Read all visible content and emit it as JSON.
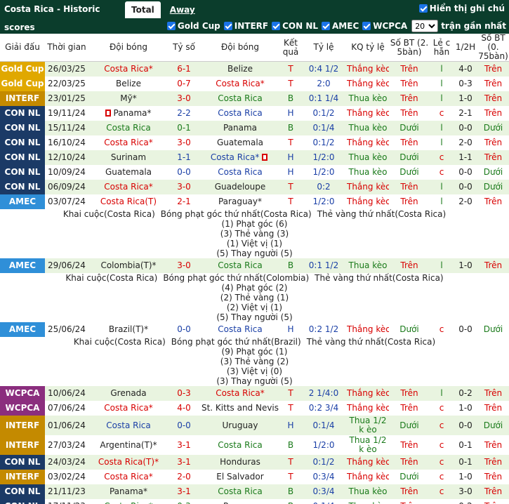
{
  "title": "Costa Rica - Historic scores",
  "tabs": [
    {
      "label": "Total"
    },
    {
      "label": "Away"
    }
  ],
  "show_notes_label": "Hiển thị ghi chú",
  "filters": [
    {
      "label": "Gold Cup"
    },
    {
      "label": "INTERF"
    },
    {
      "label": "CON NL"
    },
    {
      "label": "AMEC"
    },
    {
      "label": "WCPCA"
    }
  ],
  "recent": {
    "value": "20",
    "label": "trận gần nhất"
  },
  "columns": {
    "league": "Giải đấu",
    "time": "Thời gian",
    "home": "Đội bóng",
    "score": "Tỷ số",
    "away": "Đội bóng",
    "result": "Kết quả",
    "odds": "Tỷ lệ",
    "odds_result": "KQ tỷ lệ",
    "goals5": "Số BT (2. 5bàn)",
    "evenodd": "Lẻ c hẵn",
    "half": "1/2H",
    "goals75": "Số BT (0. 75bàn)"
  },
  "colors": {
    "gold": "#e0a800",
    "interf": "#c48a00",
    "conl": "#1b3a66",
    "amec": "#2f8fd8",
    "wcpca": "#8b2e7e"
  },
  "matches": [
    {
      "league": "Gold Cup",
      "lc": "gold",
      "date": "26/03/25",
      "home": "Costa Rica*",
      "hc": "red",
      "score": "6-1",
      "sc": "red",
      "away": "Belize",
      "ac": "",
      "res": "T",
      "rc": "red",
      "odds": "0:4 1/2",
      "kq": "Thắng kèo",
      "kc": "red",
      "g5": "Trên",
      "g5c": "red",
      "oe": "l",
      "oec": "green",
      "half": "4-0",
      "g75": "Trên",
      "g75c": "red"
    },
    {
      "league": "Gold Cup",
      "lc": "gold",
      "date": "22/03/25",
      "home": "Belize",
      "hc": "",
      "score": "0-7",
      "sc": "red",
      "away": "Costa Rica*",
      "ac": "red",
      "res": "T",
      "rc": "red",
      "odds": "2:0",
      "kq": "Thắng kèo",
      "kc": "red",
      "g5": "Trên",
      "g5c": "red",
      "oe": "l",
      "oec": "green",
      "half": "0-3",
      "g75": "Trên",
      "g75c": "red"
    },
    {
      "league": "INTERF",
      "lc": "interf",
      "date": "23/01/25",
      "home": "Mỹ*",
      "hc": "",
      "score": "3-0",
      "sc": "red",
      "away": "Costa Rica",
      "ac": "green",
      "res": "B",
      "rc": "green",
      "odds": "0:1 1/4",
      "kq": "Thua kèo",
      "kc": "green",
      "g5": "Trên",
      "g5c": "red",
      "oe": "l",
      "oec": "green",
      "half": "1-0",
      "g75": "Trên",
      "g75c": "red"
    },
    {
      "league": "CON NL",
      "lc": "conl",
      "date": "19/11/24",
      "home": "Panama*",
      "hc": "",
      "hflag": true,
      "score": "2-2",
      "sc": "blue",
      "away": "Costa Rica",
      "ac": "blue",
      "res": "H",
      "rc": "blue",
      "odds": "0:1/2",
      "kq": "Thắng kèo",
      "kc": "red",
      "g5": "Trên",
      "g5c": "red",
      "oe": "c",
      "oec": "red",
      "half": "2-1",
      "g75": "Trên",
      "g75c": "red"
    },
    {
      "league": "CON NL",
      "lc": "conl",
      "date": "15/11/24",
      "home": "Costa Rica",
      "hc": "green",
      "score": "0-1",
      "sc": "green",
      "away": "Panama",
      "ac": "",
      "res": "B",
      "rc": "green",
      "odds": "0:1/4",
      "kq": "Thua kèo",
      "kc": "green",
      "g5": "Dưới",
      "g5c": "green",
      "oe": "l",
      "oec": "green",
      "half": "0-0",
      "g75": "Dưới",
      "g75c": "green"
    },
    {
      "league": "CON NL",
      "lc": "conl",
      "date": "16/10/24",
      "home": "Costa Rica*",
      "hc": "red",
      "score": "3-0",
      "sc": "red",
      "away": "Guatemala",
      "ac": "",
      "res": "T",
      "rc": "red",
      "odds": "0:1/2",
      "kq": "Thắng kèo",
      "kc": "red",
      "g5": "Trên",
      "g5c": "red",
      "oe": "l",
      "oec": "green",
      "half": "2-0",
      "g75": "Trên",
      "g75c": "red"
    },
    {
      "league": "CON NL",
      "lc": "conl",
      "date": "12/10/24",
      "home": "Surinam",
      "hc": "",
      "score": "1-1",
      "sc": "blue",
      "away": "Costa Rica*",
      "ac": "blue",
      "aflag": true,
      "res": "H",
      "rc": "blue",
      "odds": "1/2:0",
      "kq": "Thua kèo",
      "kc": "green",
      "g5": "Dưới",
      "g5c": "green",
      "oe": "c",
      "oec": "red",
      "half": "1-1",
      "g75": "Trên",
      "g75c": "red"
    },
    {
      "league": "CON NL",
      "lc": "conl",
      "date": "10/09/24",
      "home": "Guatemala",
      "hc": "",
      "score": "0-0",
      "sc": "blue",
      "away": "Costa Rica",
      "ac": "blue",
      "res": "H",
      "rc": "blue",
      "odds": "1/2:0",
      "kq": "Thua kèo",
      "kc": "green",
      "g5": "Dưới",
      "g5c": "green",
      "oe": "c",
      "oec": "red",
      "half": "0-0",
      "g75": "Dưới",
      "g75c": "green"
    },
    {
      "league": "CON NL",
      "lc": "conl",
      "date": "06/09/24",
      "home": "Costa Rica*",
      "hc": "red",
      "score": "3-0",
      "sc": "red",
      "away": "Guadeloupe",
      "ac": "",
      "res": "T",
      "rc": "red",
      "odds": "0:2",
      "kq": "Thắng kèo",
      "kc": "red",
      "g5": "Trên",
      "g5c": "red",
      "oe": "l",
      "oec": "green",
      "half": "0-0",
      "g75": "Dưới",
      "g75c": "green"
    },
    {
      "league": "AMEC",
      "lc": "amec",
      "date": "03/07/24",
      "home": "Costa Rica(T)",
      "hc": "red",
      "score": "2-1",
      "sc": "red",
      "away": "Paraguay*",
      "ac": "",
      "res": "T",
      "rc": "red",
      "odds": "1/2:0",
      "kq": "Thắng kèo",
      "kc": "red",
      "g5": "Trên",
      "g5c": "red",
      "oe": "l",
      "oec": "green",
      "half": "2-0",
      "g75": "Trên",
      "g75c": "red",
      "details": [
        "Khai cuộc(Costa Rica)|Bóng phạt góc thứ nhất(Costa Rica)|Thẻ vàng thứ nhất(Costa Rica)",
        "(1) Phạt góc (6)",
        "(3) Thẻ vàng (3)",
        "(1) Việt vị (1)",
        "(5) Thay người (5)"
      ]
    },
    {
      "league": "AMEC",
      "lc": "amec",
      "date": "29/06/24",
      "home": "Colombia(T)*",
      "hc": "",
      "score": "3-0",
      "sc": "red",
      "away": "Costa Rica",
      "ac": "green",
      "res": "B",
      "rc": "green",
      "odds": "0:1 1/2",
      "kq": "Thua kèo",
      "kc": "green",
      "g5": "Trên",
      "g5c": "red",
      "oe": "l",
      "oec": "green",
      "half": "1-0",
      "g75": "Trên",
      "g75c": "red",
      "details": [
        "Khai cuộc(Costa Rica)|Bóng phạt góc thứ nhất(Colombia)|Thẻ vàng thứ nhất(Costa Rica)",
        "(4) Phạt góc (2)",
        "(2) Thẻ vàng (1)",
        "(2) Việt vị (1)",
        "(5) Thay người (5)"
      ]
    },
    {
      "league": "AMEC",
      "lc": "amec",
      "date": "25/06/24",
      "home": "Brazil(T)*",
      "hc": "",
      "score": "0-0",
      "sc": "blue",
      "away": "Costa Rica",
      "ac": "blue",
      "res": "H",
      "rc": "blue",
      "odds": "0:2 1/2",
      "kq": "Thắng kèo",
      "kc": "red",
      "g5": "Dưới",
      "g5c": "green",
      "oe": "c",
      "oec": "red",
      "half": "0-0",
      "g75": "Dưới",
      "g75c": "green",
      "details": [
        "Khai cuộc(Costa Rica)|Bóng phạt góc thứ nhất(Brazil)|Thẻ vàng thứ nhất(Costa Rica)",
        "(9) Phạt góc (1)",
        "(3) Thẻ vàng (2)",
        "(3) Việt vị (0)",
        "(3) Thay người (5)"
      ]
    },
    {
      "league": "WCPCA",
      "lc": "wcpca",
      "date": "10/06/24",
      "home": "Grenada",
      "hc": "",
      "score": "0-3",
      "sc": "red",
      "away": "Costa Rica*",
      "ac": "red",
      "res": "T",
      "rc": "red",
      "odds": "2 1/4:0",
      "kq": "Thắng kèo",
      "kc": "red",
      "g5": "Trên",
      "g5c": "red",
      "oe": "l",
      "oec": "green",
      "half": "0-2",
      "g75": "Trên",
      "g75c": "red"
    },
    {
      "league": "WCPCA",
      "lc": "wcpca",
      "date": "07/06/24",
      "home": "Costa Rica*",
      "hc": "red",
      "score": "4-0",
      "sc": "red",
      "away": "St. Kitts and Nevis",
      "ac": "",
      "res": "T",
      "rc": "red",
      "odds": "0:2 3/4",
      "kq": "Thắng kèo",
      "kc": "red",
      "g5": "Trên",
      "g5c": "red",
      "oe": "c",
      "oec": "red",
      "half": "1-0",
      "g75": "Trên",
      "g75c": "red"
    },
    {
      "league": "INTERF",
      "lc": "interf",
      "date": "01/06/24",
      "home": "Costa Rica",
      "hc": "blue",
      "score": "0-0",
      "sc": "blue",
      "away": "Uruguay",
      "ac": "",
      "res": "H",
      "rc": "blue",
      "odds": "0:1/4",
      "kq": "Thua 1/2 k èo",
      "kc": "green",
      "tall": true,
      "g5": "Dưới",
      "g5c": "green",
      "oe": "c",
      "oec": "red",
      "half": "0-0",
      "g75": "Dưới",
      "g75c": "green"
    },
    {
      "league": "INTERF",
      "lc": "interf",
      "date": "27/03/24",
      "home": "Argentina(T)*",
      "hc": "",
      "score": "3-1",
      "sc": "red",
      "away": "Costa Rica",
      "ac": "green",
      "res": "B",
      "rc": "green",
      "odds": "1/2:0",
      "kq": "Thua 1/2 k èo",
      "kc": "green",
      "tall": true,
      "g5": "Trên",
      "g5c": "red",
      "oe": "c",
      "oec": "red",
      "half": "0-1",
      "g75": "Trên",
      "g75c": "red"
    },
    {
      "league": "CON NL",
      "lc": "conl",
      "date": "24/03/24",
      "home": "Costa Rica(T)*",
      "hc": "red",
      "score": "3-1",
      "sc": "red",
      "away": "Honduras",
      "ac": "",
      "res": "T",
      "rc": "red",
      "odds": "0:1/2",
      "kq": "Thắng kèo",
      "kc": "red",
      "g5": "Trên",
      "g5c": "red",
      "oe": "c",
      "oec": "red",
      "half": "0-1",
      "g75": "Trên",
      "g75c": "red"
    },
    {
      "league": "INTERF",
      "lc": "interf",
      "date": "03/02/24",
      "home": "Costa Rica*",
      "hc": "red",
      "score": "2-0",
      "sc": "red",
      "away": "El Salvador",
      "ac": "",
      "res": "T",
      "rc": "red",
      "odds": "0:3/4",
      "kq": "Thắng kèo",
      "kc": "red",
      "g5": "Dưới",
      "g5c": "green",
      "oe": "c",
      "oec": "red",
      "half": "1-0",
      "g75": "Trên",
      "g75c": "red"
    },
    {
      "league": "CON NL",
      "lc": "conl",
      "date": "21/11/23",
      "home": "Panama*",
      "hc": "",
      "score": "3-1",
      "sc": "red",
      "away": "Costa Rica",
      "ac": "green",
      "res": "B",
      "rc": "green",
      "odds": "0:3/4",
      "kq": "Thua kèo",
      "kc": "green",
      "g5": "Trên",
      "g5c": "red",
      "oe": "c",
      "oec": "red",
      "half": "3-0",
      "g75": "Trên",
      "g75c": "red"
    },
    {
      "league": "CON NL",
      "lc": "conl",
      "date": "17/11/23",
      "home": "Costa Rica*",
      "hc": "green",
      "score": "0-3",
      "sc": "green",
      "away": "Panama",
      "ac": "",
      "res": "B",
      "rc": "green",
      "odds": "0:1/4",
      "kq": "Thua kèo",
      "kc": "green",
      "g5": "Trên",
      "g5c": "red",
      "oe": "c",
      "oec": "red",
      "half": "0-2",
      "g75": "Trên",
      "g75c": "red"
    }
  ]
}
